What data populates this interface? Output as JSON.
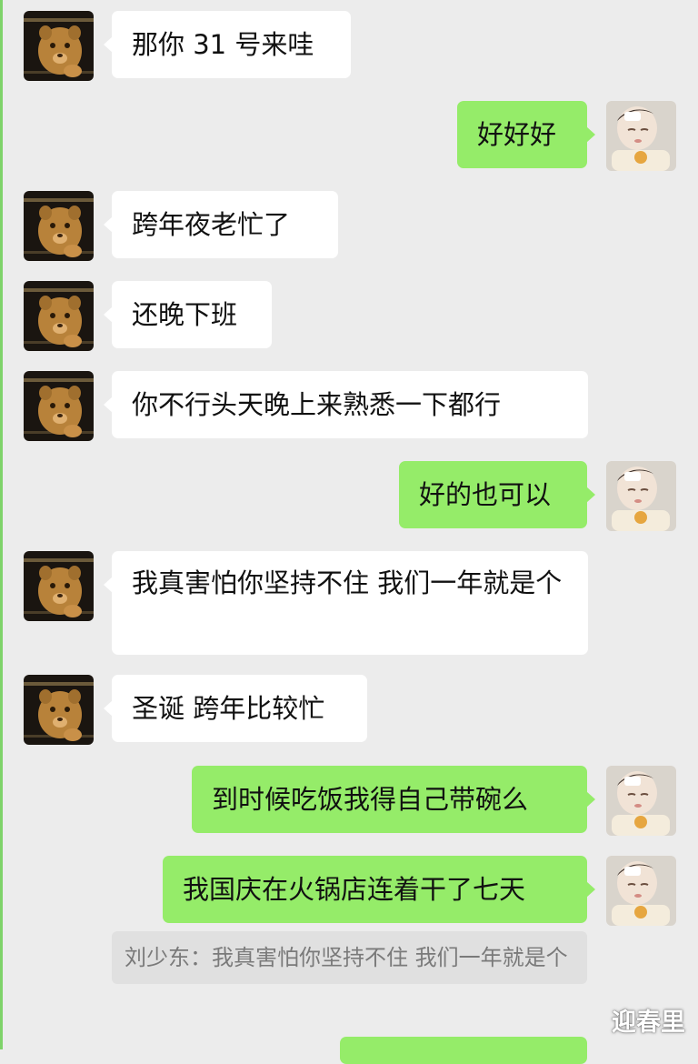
{
  "messages": [
    {
      "side": "left",
      "text": "那你 31 号来哇"
    },
    {
      "side": "right",
      "text": "好好好"
    },
    {
      "side": "left",
      "text": "跨年夜老忙了"
    },
    {
      "side": "left",
      "text": "还晚下班"
    },
    {
      "side": "left",
      "text": "你不行头天晚上来熟悉一下都行"
    },
    {
      "side": "right",
      "text": "好的也可以"
    },
    {
      "side": "left",
      "text": "我真害怕你坚持不住 我们一年就是个"
    },
    {
      "side": "left",
      "text": "圣诞 跨年比较忙"
    },
    {
      "side": "right",
      "text": "到时候吃饭我得自己带碗么"
    },
    {
      "side": "right",
      "text": "我国庆在火锅店连着干了七天"
    }
  ],
  "quote": {
    "text": "刘少东：我真害怕你坚持不住 我们一年就是个"
  },
  "watermark": "迎春里",
  "icons": {
    "contact_avatar": "lion-cub-avatar-icon",
    "self_avatar": "baby-photo-avatar-icon"
  },
  "colors": {
    "background": "#ececec",
    "incoming_bubble": "#ffffff",
    "outgoing_bubble": "#95ec69",
    "quote_bg": "#e0e0e0"
  }
}
